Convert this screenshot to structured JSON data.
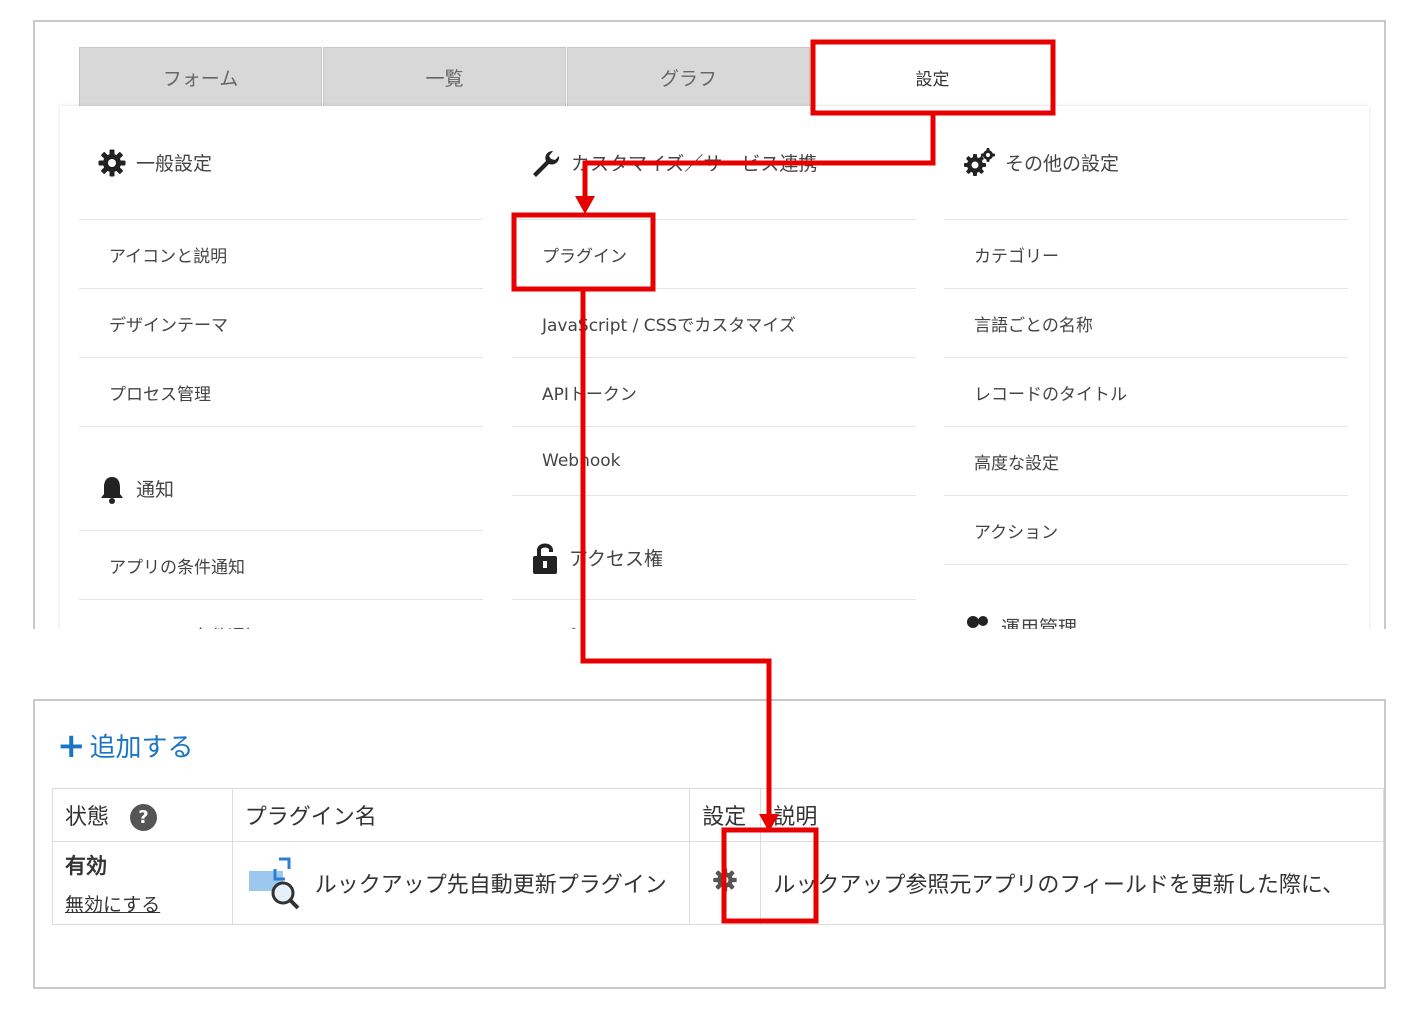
{
  "tabs": [
    {
      "label": "フォーム"
    },
    {
      "label": "一覧"
    },
    {
      "label": "グラフ"
    },
    {
      "label": "設定"
    }
  ],
  "settings": {
    "general": {
      "title": "一般設定",
      "items": [
        "アイコンと説明",
        "デザインテーマ",
        "プロセス管理"
      ]
    },
    "notification": {
      "title": "通知",
      "items": [
        "アプリの条件通知",
        "レコードの条件通知"
      ]
    },
    "customize": {
      "title": "カスタマイズ／サービス連携",
      "items": [
        "プラグイン",
        "JavaScript / CSSでカスタマイズ",
        "APIトークン",
        "Webhook"
      ]
    },
    "access": {
      "title": "アクセス権",
      "items": [
        "アプリ"
      ]
    },
    "other": {
      "title": "その他の設定",
      "items": [
        "カテゴリー",
        "言語ごとの名称",
        "レコードのタイトル",
        "高度な設定",
        "アクション"
      ]
    },
    "operation": {
      "title": "運用管理"
    }
  },
  "plugins": {
    "add_label": "追加する",
    "columns": {
      "status": "状態",
      "name": "プラグイン名",
      "settings": "設定",
      "description": "説明"
    },
    "rows": [
      {
        "status": "有効",
        "toggle": "無効にする",
        "name": "ルックアップ先自動更新プラグイン",
        "description": "ルックアップ参照元アプリのフィールドを更新した際に、"
      }
    ]
  },
  "colors": {
    "highlight": "#e60000",
    "link": "#1a75c2",
    "tab_inactive": "#d8d8d8"
  }
}
